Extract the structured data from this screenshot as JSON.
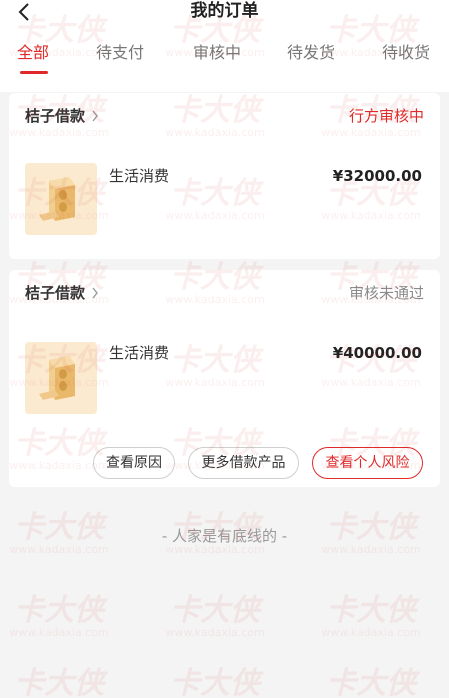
{
  "header": {
    "title": "我的订单",
    "back_icon": "chevron-left-icon"
  },
  "tabs": [
    {
      "label": "全部",
      "active": true
    },
    {
      "label": "待支付",
      "active": false
    },
    {
      "label": "审核中",
      "active": false
    },
    {
      "label": "待发货",
      "active": false
    },
    {
      "label": "待收货",
      "active": false
    }
  ],
  "orders": [
    {
      "lender": "桔子借款",
      "status": "行方审核中",
      "purpose": "生活消费",
      "amount": "¥32000.00"
    },
    {
      "lender": "桔子借款",
      "status": "审核未通过",
      "purpose": "生活消费",
      "amount": "¥40000.00",
      "actions": {
        "reason": "查看原因",
        "more": "更多借款产品",
        "risk": "查看个人风险"
      }
    }
  ],
  "footer_note": "- 人家是有底线的 -",
  "colors": {
    "accent": "#e02a2a",
    "muted": "#8a8a8a",
    "background": "#f4f4f4"
  },
  "watermark": {
    "text": "卡大侠",
    "url": "www.kadaxia.com"
  }
}
